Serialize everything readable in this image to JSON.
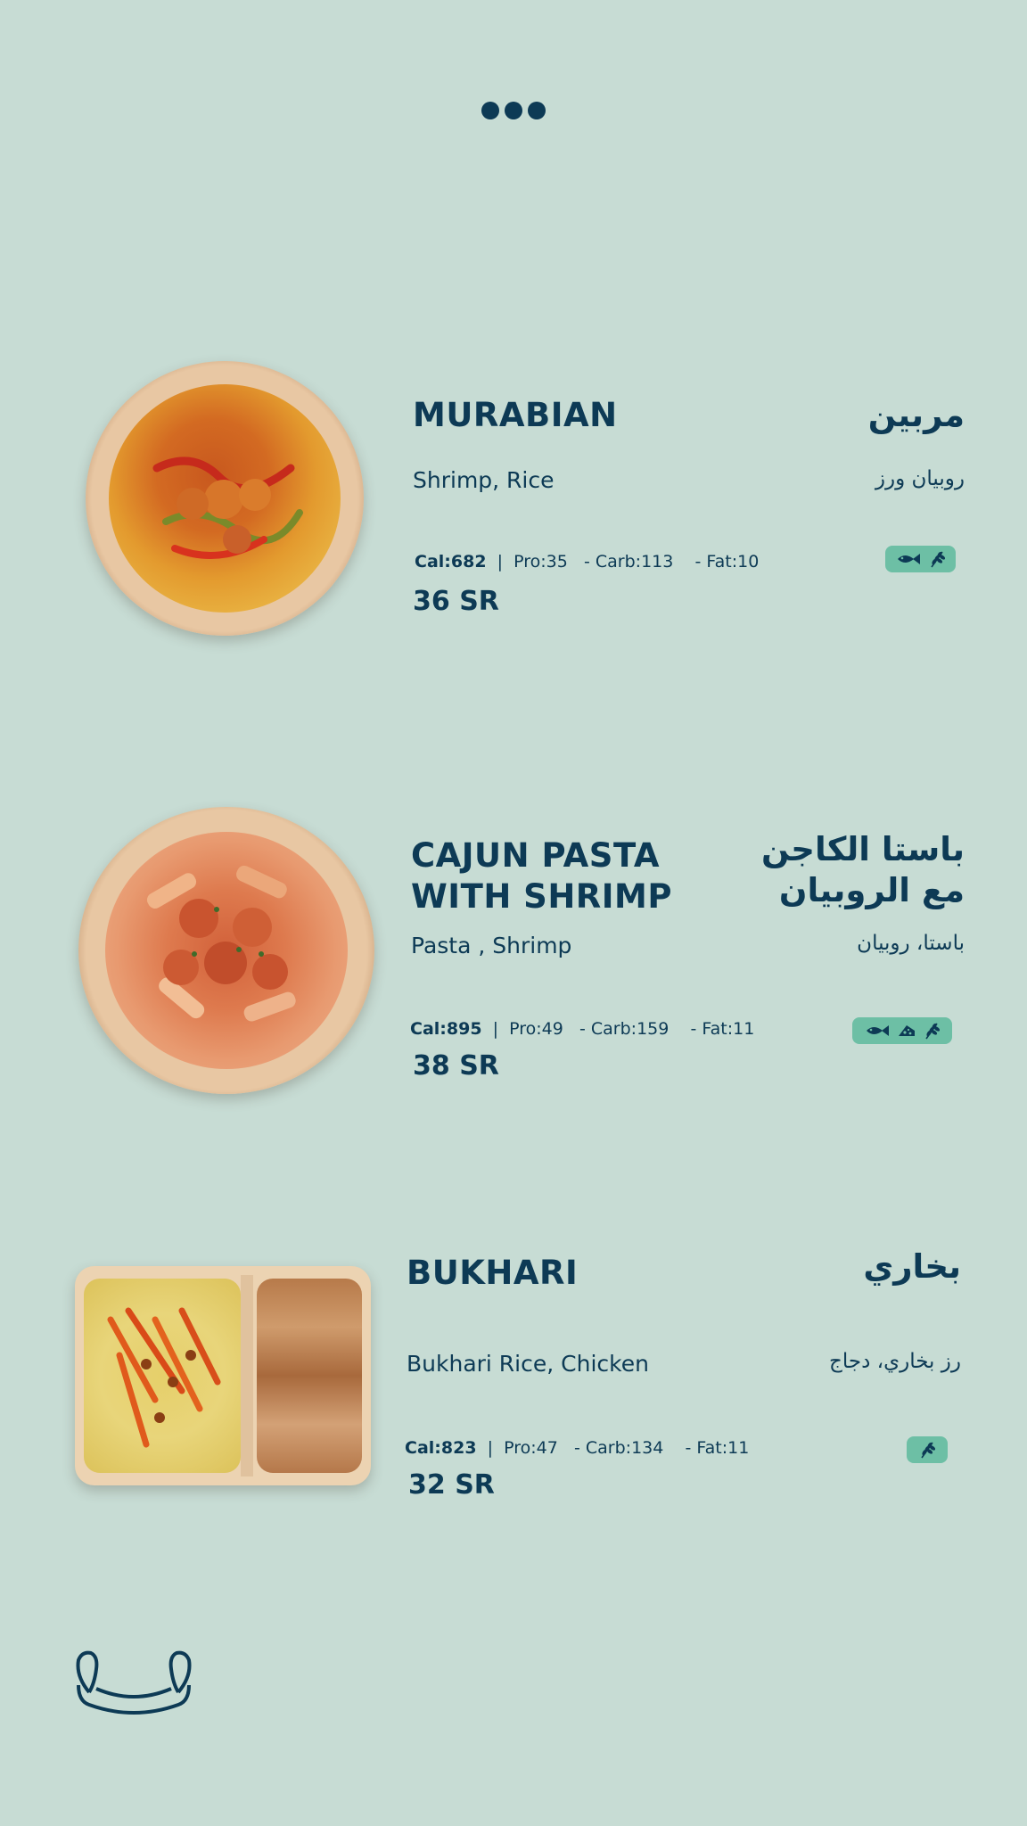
{
  "items": [
    {
      "name_en": "MURABIAN",
      "name_ar": "مربين",
      "desc_en": "Shrimp, Rice",
      "desc_ar": "روبيان ورز",
      "cal": "Cal:682",
      "pro": "Pro:35",
      "carb": "- Carb:113",
      "fat": "- Fat:10",
      "price": "36 SR",
      "badges": [
        "fish-icon",
        "wheat-icon"
      ]
    },
    {
      "name_en": "CAJUN PASTA\nWITH SHRIMP",
      "name_ar": "باستا الكاجن\nمع الروبيان",
      "desc_en": "Pasta , Shrimp",
      "desc_ar": "باستا، روبيان",
      "cal": "Cal:895",
      "pro": "Pro:49",
      "carb": "- Carb:159",
      "fat": "- Fat:11",
      "price": "38 SR",
      "badges": [
        "fish-icon",
        "cheese-icon",
        "wheat-icon"
      ]
    },
    {
      "name_en": "BUKHARI",
      "name_ar": "بخاري",
      "desc_en": "Bukhari Rice, Chicken",
      "desc_ar": "رز بخاري، دجاج",
      "cal": "Cal:823",
      "pro": "Pro:47",
      "carb": "- Carb:134",
      "fat": "- Fat:11",
      "price": "32 SR",
      "badges": [
        "wheat-icon"
      ]
    }
  ],
  "colors": {
    "background": "#c7dcd4",
    "text": "#0d3a55",
    "badge": "#6dbfa5"
  }
}
